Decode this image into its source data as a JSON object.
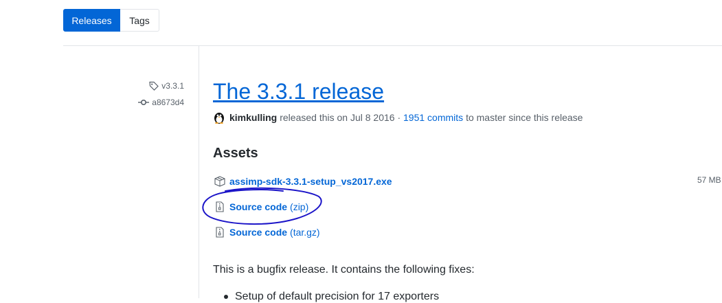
{
  "tabs": {
    "releases": "Releases",
    "tags": "Tags"
  },
  "meta": {
    "tag": "v3.3.1",
    "commit": "a8673d4"
  },
  "release": {
    "title": "The 3.3.1 release",
    "author": "kimkulling",
    "released_text": "released this on Jul 8 2016 ·",
    "commits_link": "1951 commits",
    "commits_suffix": "to master since this release"
  },
  "assets": {
    "heading": "Assets",
    "items": [
      {
        "name": "assimp-sdk-3.3.1-setup_vs2017.exe",
        "size": "57 MB"
      },
      {
        "name": "Source code",
        "ext": "(zip)"
      },
      {
        "name": "Source code",
        "ext": "(tar.gz)"
      }
    ]
  },
  "notes": {
    "intro": "This is a bugfix release. It contains the following fixes:",
    "bullets": [
      "Setup of default precision for 17 exporters"
    ]
  },
  "colors": {
    "accent": "#0366d6",
    "annotation": "#1b14c8"
  }
}
